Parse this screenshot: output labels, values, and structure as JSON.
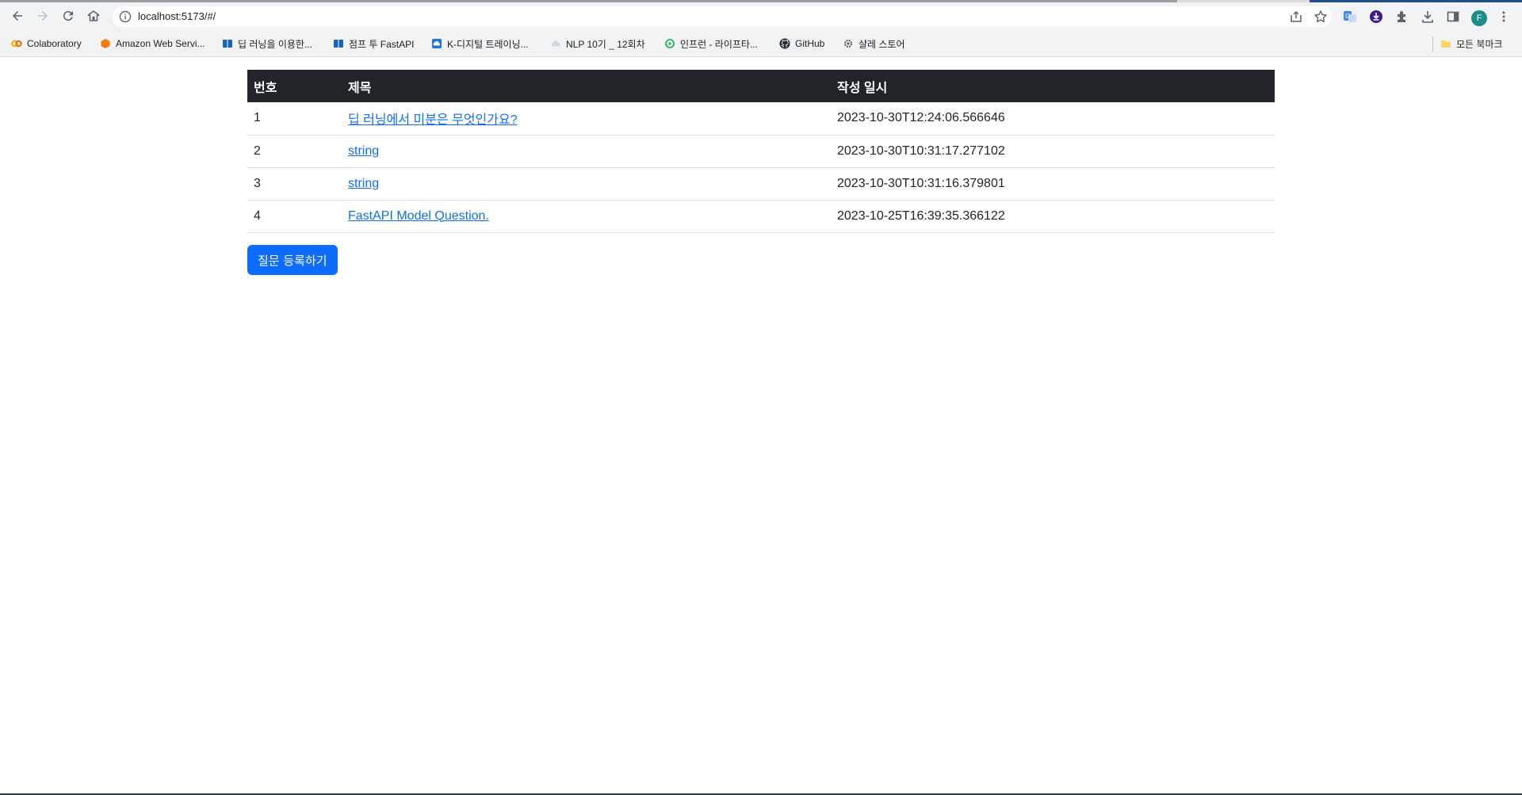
{
  "browser": {
    "url": "localhost:5173/#/",
    "bookmarks": [
      {
        "label": "Colaboratory",
        "icon": "colab-icon",
        "color": "#f9ab00"
      },
      {
        "label": "Amazon Web Servi...",
        "icon": "aws-icon",
        "color": "#f57c00"
      },
      {
        "label": "딥 러닝을 이용한...",
        "icon": "wikidocs-icon",
        "color": "#1565c0"
      },
      {
        "label": "점프 투 FastAPI",
        "icon": "wikidocs-icon",
        "color": "#1565c0"
      },
      {
        "label": "K-디지털 트레이닝...",
        "icon": "cloud-icon",
        "color": "#1a73e8"
      },
      {
        "label": "NLP 10기 _ 12회차",
        "icon": "cloud-icon",
        "color": "#b0bec5"
      },
      {
        "label": "인프런 - 라이프타...",
        "icon": "inflearn-icon",
        "color": "#1db954"
      },
      {
        "label": "GitHub",
        "icon": "github-icon",
        "color": "#24292e"
      },
      {
        "label": "샬레 스토어",
        "icon": "gear-icon",
        "color": "#555555"
      }
    ],
    "all_bookmarks_label": "모든 북마크",
    "profile_initial": "F"
  },
  "table": {
    "headers": {
      "number": "번호",
      "subject": "제목",
      "created": "작성 일시"
    },
    "rows": [
      {
        "number": "1",
        "subject": "딥 러닝에서 미분은 무엇인가요?",
        "created": "2023-10-30T12:24:06.566646"
      },
      {
        "number": "2",
        "subject": "string",
        "created": "2023-10-30T10:31:17.277102"
      },
      {
        "number": "3",
        "subject": "string",
        "created": "2023-10-30T10:31:16.379801"
      },
      {
        "number": "4",
        "subject": "FastAPI Model Question.",
        "created": "2023-10-25T16:39:35.366122"
      }
    ]
  },
  "actions": {
    "register_label": "질문 등록하기"
  },
  "colors": {
    "header_bg": "#212529",
    "link": "#0d6efd",
    "primary_button": "#0d6efd"
  }
}
